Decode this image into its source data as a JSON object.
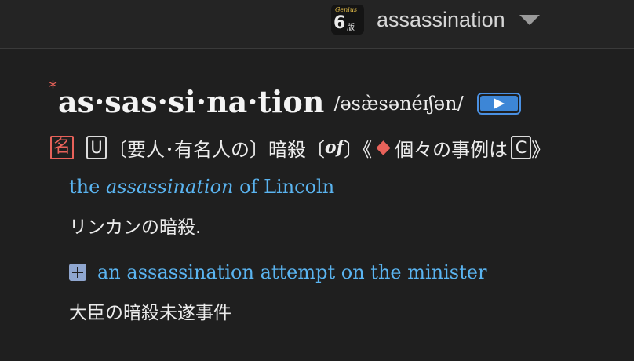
{
  "dictionary": {
    "app_brand": "Genius",
    "app_edition": "6",
    "app_edition_suffix": "版",
    "name": "assassination",
    "dropdown_icon": "chevron-down-icon"
  },
  "entry": {
    "star": "*",
    "headword": "as·sas·si·na·tion",
    "pronunciation": "/əsæ̀sənéɪʃən/",
    "audio_icon": "play-icon",
    "accent_color": "#e8625a",
    "link_color": "#5ab4f0",
    "audio_color": "#3d86d6"
  },
  "sense": {
    "pos": "名",
    "uncountable": "U",
    "gloss_before": "〔要人･有名人の〕暗殺〔",
    "gloss_of": "of",
    "gloss_mid": "〕《",
    "gloss_after": "個々の事例は",
    "countable": "C",
    "gloss_end": "》"
  },
  "examples": [
    {
      "before": "the ",
      "emph": "assassination",
      "after": " of Lincoln",
      "translation": "リンカンの暗殺."
    },
    {
      "icon": "plus-icon",
      "text": "an assassination attempt on the minister",
      "translation": "大臣の暗殺未遂事件"
    }
  ]
}
